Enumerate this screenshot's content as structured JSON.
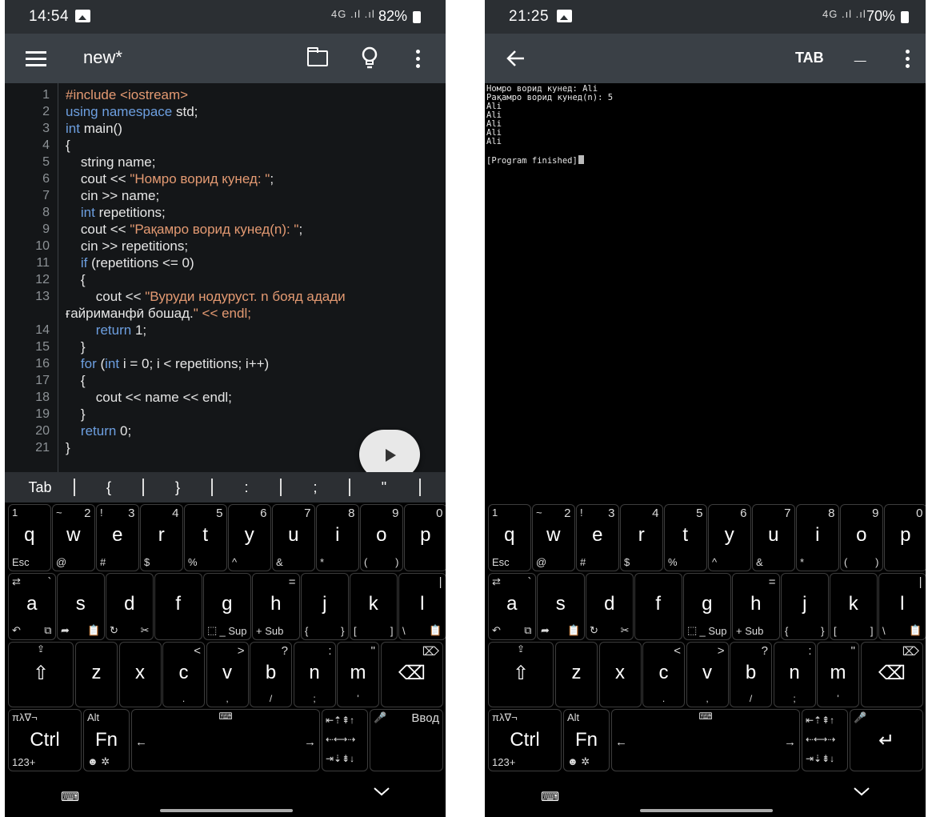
{
  "left_screen": {
    "status": {
      "time": "14:54",
      "signal": "4G .ıl .ıl",
      "battery": "82%"
    },
    "appbar": {
      "title": "new*",
      "icons": [
        "menu-icon",
        "folder-icon",
        "lightbulb-icon",
        "more-vert-icon"
      ]
    },
    "code": [
      {
        "n": "1",
        "t": "#include <iostream>"
      },
      {
        "n": "2",
        "t": "using namespace std;"
      },
      {
        "n": "3",
        "t": "int main()"
      },
      {
        "n": "4",
        "t": "{"
      },
      {
        "n": "5",
        "t": "    string name;"
      },
      {
        "n": "6",
        "t": "    cout << \"Номро ворид кунед: \";"
      },
      {
        "n": "7",
        "t": "    cin >> name;"
      },
      {
        "n": "8",
        "t": "    int repetitions;"
      },
      {
        "n": "9",
        "t": "    cout << \"Рақамро ворид кунед(n): \";"
      },
      {
        "n": "10",
        "t": "    cin >> repetitions;"
      },
      {
        "n": "11",
        "t": "    if (repetitions <= 0)"
      },
      {
        "n": "12",
        "t": "    {"
      },
      {
        "n": "13",
        "t": "        cout << \"Вуруди нодуруст. n бояд адади"
      },
      {
        "n": "",
        "t": "ғайриманфӣ бошад.\" << endl;"
      },
      {
        "n": "14",
        "t": "        return 1;"
      },
      {
        "n": "15",
        "t": "    }"
      },
      {
        "n": "16",
        "t": "    for (int i = 0; i < repetitions; i++)"
      },
      {
        "n": "17",
        "t": "    {"
      },
      {
        "n": "18",
        "t": "        cout << name << endl;"
      },
      {
        "n": "19",
        "t": "    }"
      },
      {
        "n": "20",
        "t": "    return 0;"
      },
      {
        "n": "21",
        "t": "}"
      }
    ],
    "extra_keys": [
      "Tab",
      "{",
      "}",
      ":",
      ";",
      "\""
    ]
  },
  "right_screen": {
    "status": {
      "time": "21:25",
      "signal": "4G .ıl .ıl",
      "battery": "70%"
    },
    "appbar": {
      "tab_label": "TAB",
      "underscore_label": "_",
      "icons": [
        "back-arrow-icon",
        "more-vert-icon"
      ]
    },
    "terminal_lines": [
      "Номро ворид кунед: Ali",
      "Рақамро ворид кунед(n): 5",
      "Ali",
      "Ali",
      "Ali",
      "Ali",
      "Ali",
      "",
      "[Program finished]"
    ]
  },
  "keyboard": {
    "row1": [
      {
        "main": "q",
        "tl": "1",
        "bl": "Esc"
      },
      {
        "main": "w",
        "tl": "~",
        "tr": "2",
        "bl": "@"
      },
      {
        "main": "e",
        "tl": "!",
        "tr": "3",
        "bl": "#"
      },
      {
        "main": "r",
        "tr": "4",
        "bl": "$"
      },
      {
        "main": "t",
        "tr": "5",
        "bl": "%"
      },
      {
        "main": "y",
        "tr": "6",
        "bl": "^"
      },
      {
        "main": "u",
        "tr": "7",
        "bl": "&"
      },
      {
        "main": "i",
        "tr": "8",
        "bl": "*"
      },
      {
        "main": "o",
        "tr": "9",
        "bl": "(",
        "br": ")"
      },
      {
        "main": "p",
        "tr": "0"
      }
    ],
    "row2": [
      {
        "main": "a",
        "tl": "⇄",
        "tr": "`",
        "bl": "↶",
        "br": "⧉"
      },
      {
        "main": "s",
        "bl": "➦",
        "br": "📋"
      },
      {
        "main": "d",
        "bl": "↻",
        "br": "✂"
      },
      {
        "main": "f"
      },
      {
        "main": "g",
        "bl": "⬚",
        "br": "_ Sup"
      },
      {
        "main": "h",
        "tr": "=",
        "bl": "+ Sub"
      },
      {
        "main": "j",
        "bl": "{",
        "br": "}"
      },
      {
        "main": "k",
        "bl": "[",
        "br": "]"
      },
      {
        "main": "l",
        "tr": "|",
        "bl": "\\",
        "br": "📋"
      }
    ],
    "row3": [
      {
        "main": "⇧",
        "tm": "⇪"
      },
      {
        "main": "z"
      },
      {
        "main": "x"
      },
      {
        "main": "c",
        "tr": "<",
        "bm": "."
      },
      {
        "main": "v",
        "tr": ">",
        "bm": ","
      },
      {
        "main": "b",
        "tr": "?",
        "bm": "/"
      },
      {
        "main": "n",
        "tr": ":",
        "bm": ";"
      },
      {
        "main": "m",
        "tr": "\"",
        "bm": "'"
      },
      {
        "main": "⌫",
        "tr": "⌦"
      }
    ],
    "row4": {
      "ctrl": {
        "main": "Ctrl",
        "tl": "πλ∇¬",
        "bl": "123+"
      },
      "fn": {
        "main": "Fn",
        "tl": "Alt",
        "bl": "☻ ✲"
      },
      "space": {
        "left": "←",
        "right": "→",
        "top": "⌨"
      },
      "arrows": {
        "top": "⇤⇡⇞↑",
        "mid": "⇠⟷⇢",
        "bot": "⇥⇣⇟↓"
      },
      "enter_left": {
        "main": "",
        "tl": "🎤",
        "tr": "Ввод"
      },
      "enter_right": {
        "main": "↵",
        "tl": "🎤"
      }
    }
  },
  "navbar": {
    "keyboard_icon": "⌨",
    "chevron_icon": "chevron-down-icon"
  }
}
